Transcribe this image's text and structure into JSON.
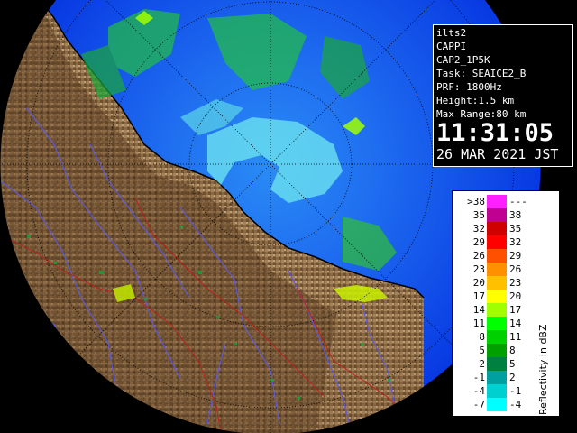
{
  "info": {
    "station": "ilts2",
    "product": "CAPPI",
    "product_id": "CAP2_1P5K",
    "task": "Task: SEAICE2_B",
    "prf": "PRF: 1800Hz",
    "height": "Height:1.5 km",
    "max_range": "Max Range:80 km",
    "time": "11:31:05",
    "date": "26 MAR 2021 JST"
  },
  "legend": {
    "title": "Reflectivity in dBZ",
    "rows": [
      {
        "lo": ">38",
        "hi": "---",
        "color": "#ff20ff"
      },
      {
        "lo": "35",
        "hi": "38",
        "color": "#c00090"
      },
      {
        "lo": "32",
        "hi": "35",
        "color": "#d00000"
      },
      {
        "lo": "29",
        "hi": "32",
        "color": "#ff0000"
      },
      {
        "lo": "26",
        "hi": "29",
        "color": "#ff5000"
      },
      {
        "lo": "23",
        "hi": "26",
        "color": "#ff9000"
      },
      {
        "lo": "20",
        "hi": "23",
        "color": "#ffc000"
      },
      {
        "lo": "17",
        "hi": "20",
        "color": "#ffff00"
      },
      {
        "lo": "14",
        "hi": "17",
        "color": "#a0ff00"
      },
      {
        "lo": "11",
        "hi": "14",
        "color": "#00ff00"
      },
      {
        "lo": "8",
        "hi": "11",
        "color": "#00d000"
      },
      {
        "lo": "5",
        "hi": "8",
        "color": "#00a000"
      },
      {
        "lo": "2",
        "hi": "5",
        "color": "#008040"
      },
      {
        "lo": "-1",
        "hi": "2",
        "color": "#00a0a0"
      },
      {
        "lo": "-4",
        "hi": "-1",
        "color": "#00d0d0"
      },
      {
        "lo": "-7",
        "hi": "-4",
        "color": "#00ffff"
      }
    ]
  },
  "colors": {
    "sea": "#0030e0",
    "sea_inner": "#2070f0",
    "land_dark": "#5a3a20",
    "land_light": "#b89468",
    "river": "#5050e0",
    "border": "#c01010",
    "range_ring": "#000000"
  }
}
